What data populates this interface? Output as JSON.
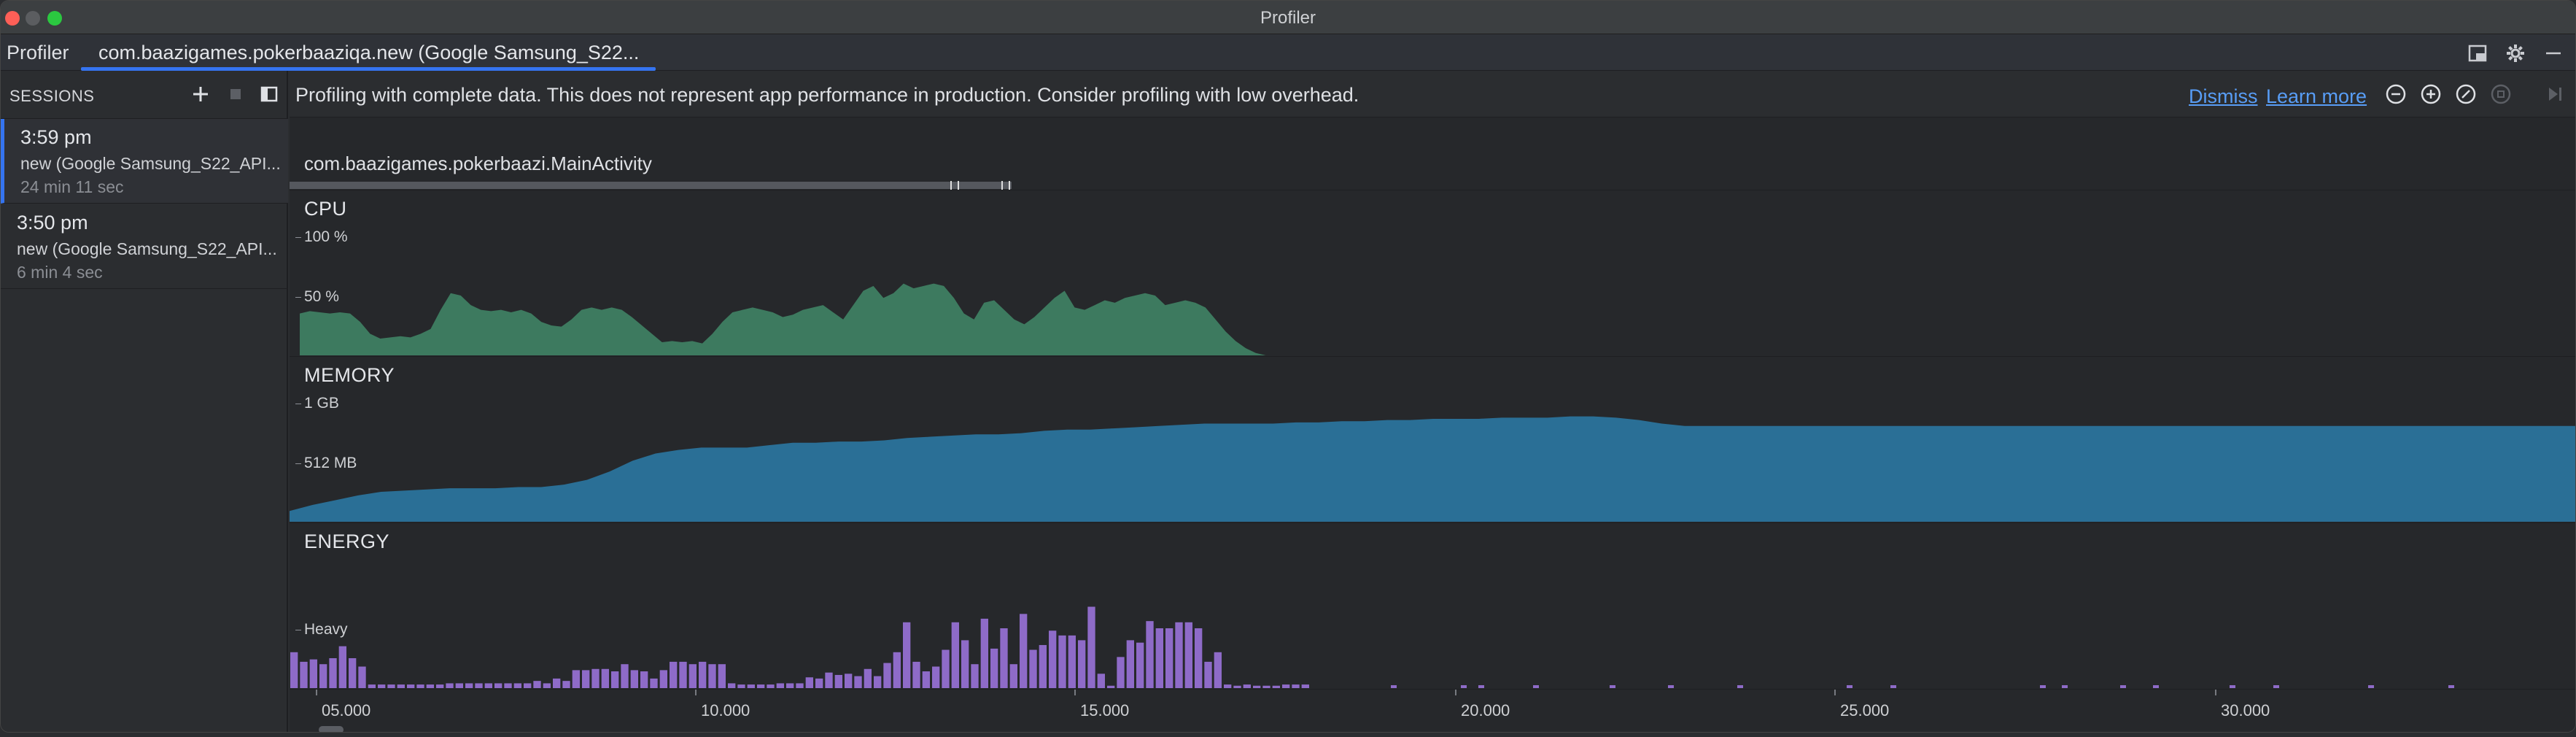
{
  "window": {
    "title": "Profiler"
  },
  "tabbar": {
    "tool_label": "Profiler",
    "active_tab": "com.baazigames.pokerbaaziqa.new (Google Samsung_S22..."
  },
  "sidebar": {
    "title": "SESSIONS",
    "sessions": [
      {
        "time": "3:59 pm",
        "name": "new (Google Samsung_S22_API...",
        "duration": "24 min 11 sec",
        "selected": true
      },
      {
        "time": "3:50 pm",
        "name": "new (Google Samsung_S22_API...",
        "duration": "6 min 4 sec",
        "selected": false
      }
    ]
  },
  "banner": {
    "message": "Profiling with complete data. This does not represent app performance in production. Consider profiling with low overhead.",
    "dismiss": "Dismiss",
    "learn_more": "Learn more"
  },
  "activity": {
    "label": "com.baazigames.pokerbaazi.MainActivity"
  },
  "lanes": {
    "cpu": {
      "title": "CPU",
      "tick_top": "100 %",
      "tick_mid": "50 %",
      "color": "#3d7a5f"
    },
    "memory": {
      "title": "MEMORY",
      "tick_top": "1 GB",
      "tick_mid": "512 MB",
      "color": "#2a6f96"
    },
    "energy": {
      "title": "ENERGY",
      "tick_mid": "Heavy",
      "color": "#8e6bc8"
    }
  },
  "time_axis": {
    "labels": [
      "05.000",
      "10.000",
      "15.000",
      "20.000",
      "25.000",
      "30.000"
    ]
  },
  "series": {
    "cpu_percent": [
      35,
      37,
      36,
      35,
      36,
      35,
      28,
      18,
      14,
      15,
      16,
      15,
      18,
      22,
      38,
      52,
      50,
      42,
      38,
      37,
      38,
      36,
      38,
      35,
      28,
      25,
      24,
      30,
      38,
      40,
      38,
      40,
      38,
      32,
      25,
      18,
      11,
      12,
      11,
      12,
      10,
      18,
      28,
      36,
      38,
      40,
      38,
      36,
      32,
      34,
      38,
      40,
      42,
      36,
      30,
      42,
      54,
      58,
      48,
      52,
      60,
      56,
      58,
      60,
      58,
      48,
      35,
      30,
      44,
      46,
      38,
      30,
      26,
      32,
      40,
      48,
      54,
      40,
      38,
      42,
      46,
      44,
      48,
      50,
      52,
      50,
      42,
      44,
      46,
      44,
      40,
      30,
      20,
      12,
      6,
      2,
      0,
      0,
      0,
      0
    ],
    "memory_percent": [
      9,
      14,
      18,
      22,
      25,
      26,
      27,
      28,
      28,
      28,
      29,
      29,
      31,
      35,
      42,
      51,
      57,
      60,
      62,
      62,
      62,
      64,
      66,
      66,
      67,
      67,
      68,
      70,
      71,
      72,
      73,
      73,
      74,
      76,
      77,
      77,
      78,
      79,
      80,
      81,
      82,
      82,
      82,
      82,
      83,
      83,
      84,
      84,
      85,
      85,
      86,
      86,
      86,
      87,
      87,
      87,
      88,
      88,
      87,
      85,
      82,
      80,
      80,
      80,
      80,
      80,
      80,
      80,
      80,
      80,
      80,
      80,
      80,
      80,
      80,
      80,
      80,
      80,
      80,
      80,
      80,
      80,
      80,
      80,
      80,
      80,
      80,
      80,
      80,
      80,
      80,
      80,
      80,
      80,
      80,
      80,
      80,
      80,
      80,
      80,
      80
    ],
    "energy_level": [
      30,
      22,
      24,
      20,
      25,
      35,
      25,
      18,
      3,
      3,
      3,
      3,
      3,
      3,
      3,
      3,
      4,
      4,
      4,
      4,
      4,
      4,
      4,
      4,
      4,
      6,
      4,
      8,
      6,
      15,
      15,
      16,
      16,
      14,
      20,
      15,
      14,
      8,
      15,
      22,
      22,
      20,
      22,
      20,
      20,
      4,
      3,
      3,
      3,
      3,
      4,
      4,
      4,
      9,
      8,
      13,
      11,
      12,
      10,
      16,
      10,
      21,
      30,
      55,
      22,
      14,
      18,
      32,
      55,
      40,
      20,
      58,
      33,
      50,
      20,
      62,
      32,
      36,
      48,
      44,
      44,
      40,
      68,
      12,
      2,
      26,
      40,
      38,
      56,
      50,
      50,
      55,
      55,
      50,
      22,
      30,
      3,
      2,
      3,
      2,
      2,
      2,
      3,
      3,
      3
    ]
  }
}
